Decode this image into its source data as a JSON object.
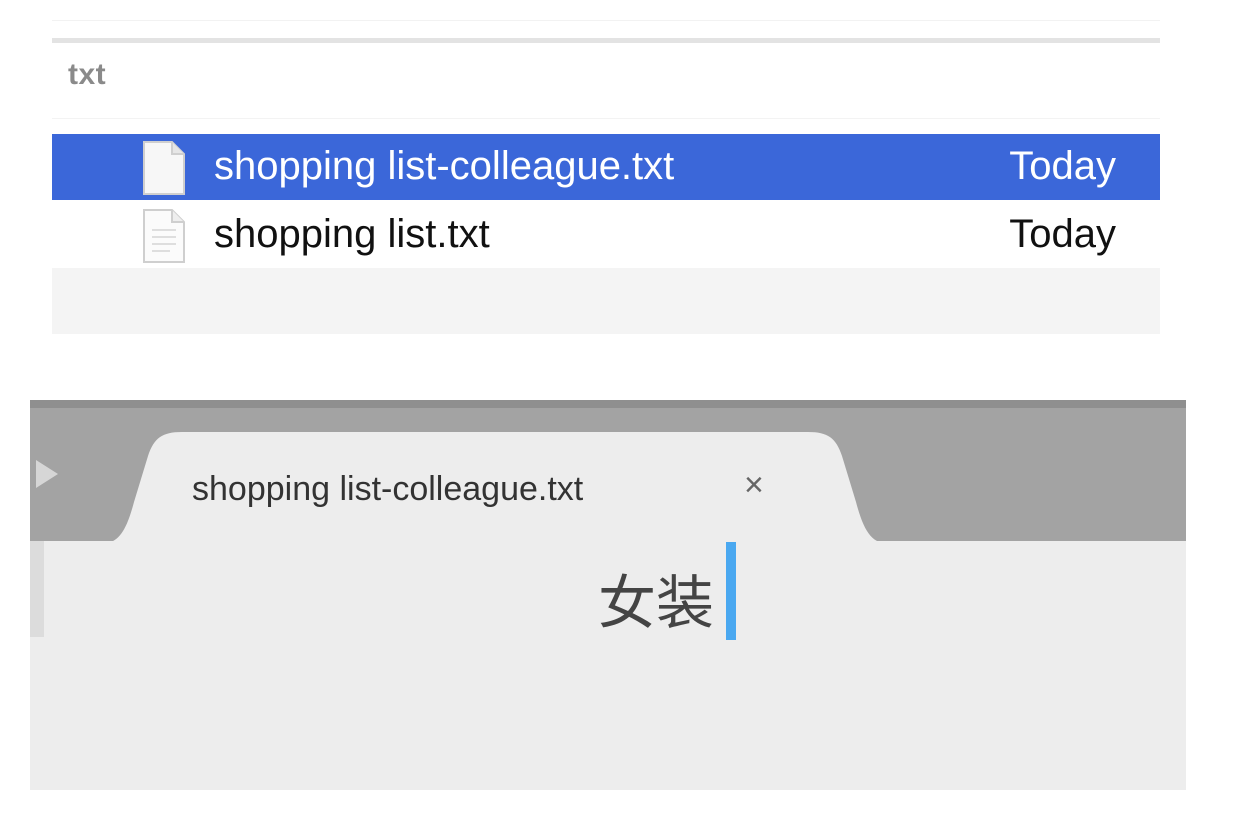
{
  "finder": {
    "group_label": "txt",
    "files": [
      {
        "name": "shopping list-colleague.txt",
        "date": "Today",
        "selected": true,
        "icon": "text-document-icon"
      },
      {
        "name": "shopping list.txt",
        "date": "Today",
        "selected": false,
        "icon": "text-document-icon"
      }
    ],
    "colors": {
      "selection": "#3b67d9"
    }
  },
  "editor": {
    "tab": {
      "title": "shopping list-colleague.txt",
      "close_glyph": "×"
    },
    "content": "女装",
    "sidebar_toggle_icon": "play-arrow-icon",
    "colors": {
      "tabbar": "#a3a3a3",
      "editor_background": "#ededed",
      "cursor": "#4aa8f0"
    }
  }
}
